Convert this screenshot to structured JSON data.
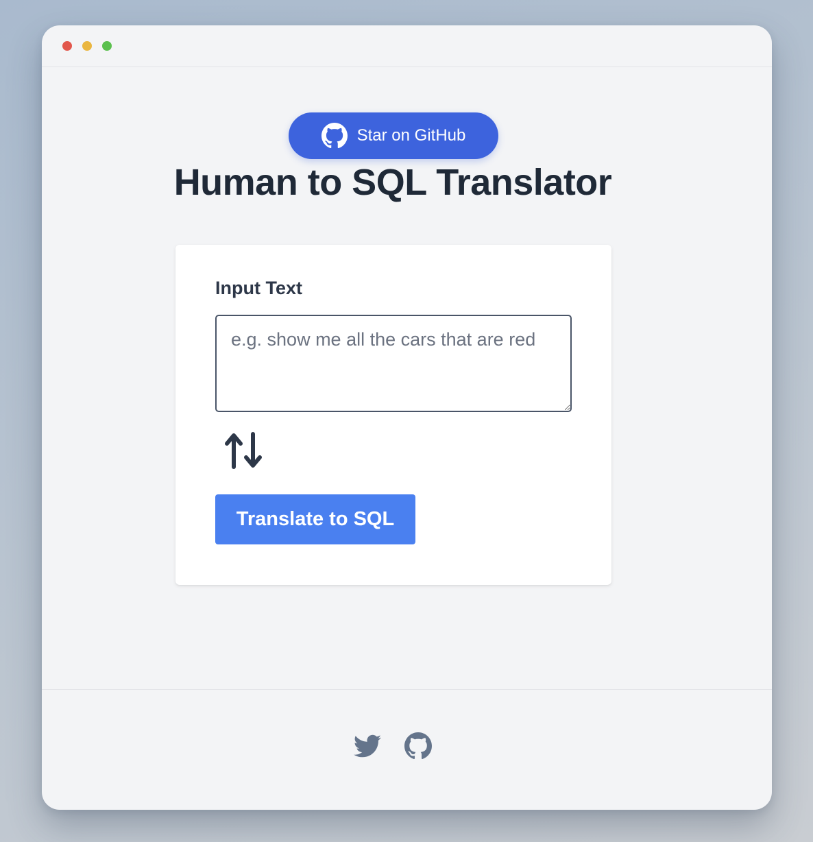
{
  "window": {
    "controls": [
      "close",
      "minimize",
      "maximize"
    ]
  },
  "header": {
    "github_button_label": "Star on GitHub",
    "github_button_icon": "github-icon",
    "title": "Human to SQL Translator"
  },
  "form": {
    "input_label": "Input Text",
    "input_placeholder": "e.g. show me all the cars that are red",
    "input_value": "",
    "swap_icon": "swap-arrows-icon",
    "submit_label": "Translate to SQL"
  },
  "footer": {
    "icons": [
      "twitter-icon",
      "github-icon"
    ]
  },
  "colors": {
    "accent": "#3d63dd",
    "button": "#4a80f0",
    "title_text": "#1f2937",
    "window_bg": "#f3f4f6"
  }
}
